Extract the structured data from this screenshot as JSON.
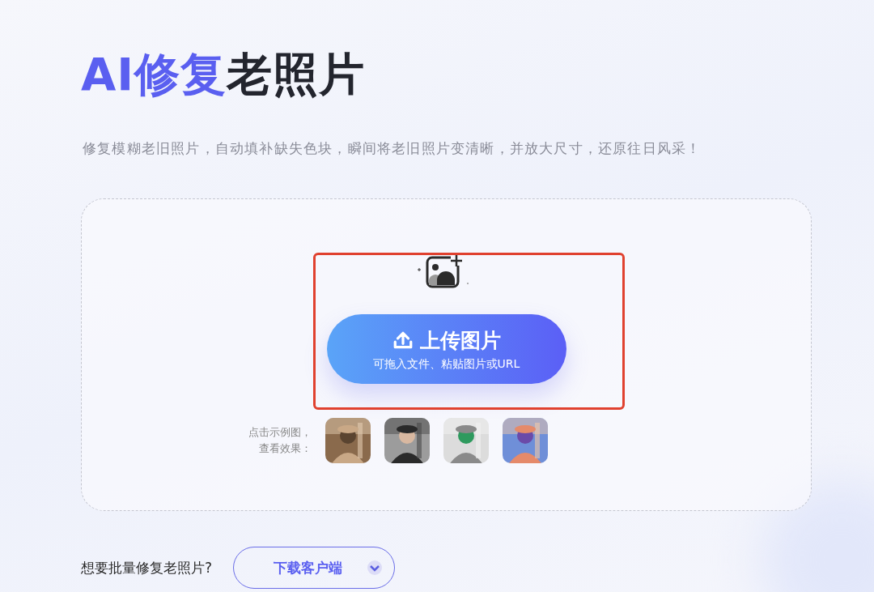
{
  "title": {
    "accent": "AI修复",
    "rest": "老照片"
  },
  "subtitle": "修复模糊老旧照片，自动填补缺失色块，瞬间将老旧照片变清晰，并放大尺寸，还原往日风采！",
  "upload": {
    "label": "上传图片",
    "hint": "可拖入文件、粘贴图片或URL"
  },
  "examples": {
    "label_lines": [
      "点击示例图，",
      "查看效果："
    ]
  },
  "batch": {
    "question": "想要批量修复老照片?",
    "button": "下载客户端"
  }
}
